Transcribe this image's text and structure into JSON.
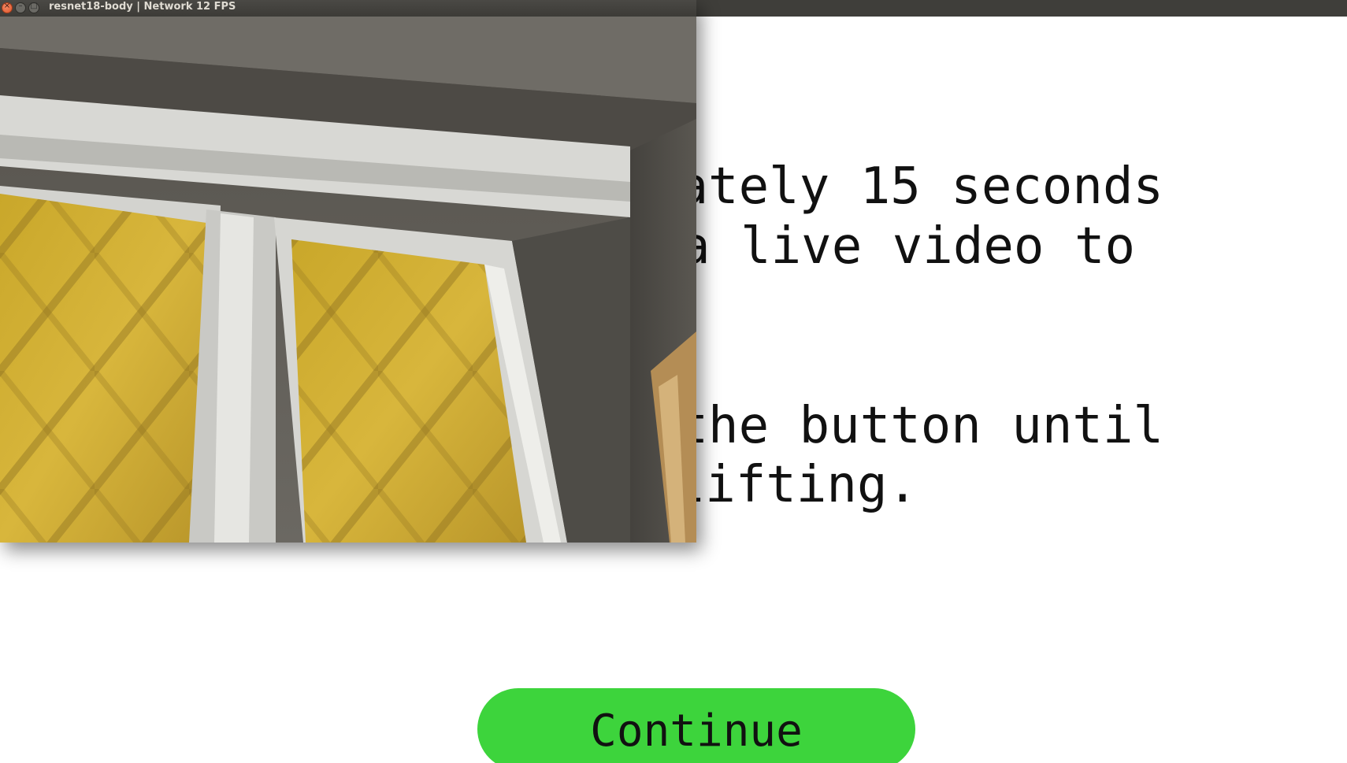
{
  "window": {
    "title": "resnet18-body | Network 12 FPS",
    "buttons": {
      "close_icon": "×",
      "minimize_icon": "–",
      "maximize_icon": "□"
    }
  },
  "instructions": {
    "line1": "ately 15 seconds",
    "line2": "a live video to",
    "line3": "the button until",
    "line4": "lifting."
  },
  "continue_button": {
    "label": "Continue",
    "color": "#3dd43c"
  },
  "colors": {
    "titlebar": "#3c3b37",
    "close_button": "#e0562a",
    "background": "#ffffff"
  }
}
